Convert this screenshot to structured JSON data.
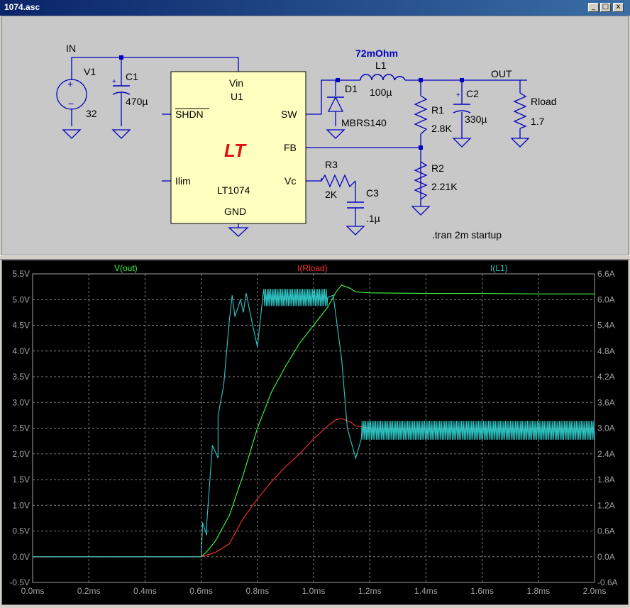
{
  "window": {
    "title": "1074.asc",
    "minimize": "_",
    "restore": "□",
    "close": "x"
  },
  "schematic": {
    "nets": {
      "in": "IN",
      "out": "OUT"
    },
    "v1": {
      "name": "V1",
      "value": "32"
    },
    "c1": {
      "name": "C1",
      "value": "470µ"
    },
    "u1": {
      "vin": "Vin",
      "name": "U1",
      "shdn": "SHDN",
      "sw": "SW",
      "fb": "FB",
      "ilim": "Ilim",
      "vc": "Vc",
      "part": "LT1074",
      "gnd": "GND",
      "logo": "LT"
    },
    "l1": {
      "name": "L1",
      "value": "100µ",
      "rser": "72mOhm"
    },
    "d1": {
      "name": "D1",
      "value": "MBRS140"
    },
    "r1": {
      "name": "R1",
      "value": "2.8K"
    },
    "c2": {
      "name": "C2",
      "value": "330µ"
    },
    "rload": {
      "name": "Rload",
      "value": "1.7"
    },
    "r2": {
      "name": "R2",
      "value": "2.21K"
    },
    "r3": {
      "name": "R3",
      "value": "2K"
    },
    "c3": {
      "name": "C3",
      "value": ".1µ"
    },
    "directive": ".tran 2m startup"
  },
  "colors": {
    "vout": "#40ff40",
    "irload": "#ff3030",
    "il1": "#30c8c8",
    "wire": "#0000c0",
    "plot_bg": "#000000"
  },
  "chart_data": {
    "type": "line",
    "x_ticks": [
      "0.0ms",
      "0.2ms",
      "0.4ms",
      "0.6ms",
      "0.8ms",
      "1.0ms",
      "1.2ms",
      "1.4ms",
      "1.6ms",
      "1.8ms",
      "2.0ms"
    ],
    "xlim": [
      0,
      2.0
    ],
    "left_ylim": [
      -0.5,
      5.5
    ],
    "right_ylim": [
      -0.6,
      6.6
    ],
    "left_ticks": [
      "5.5V",
      "5.0V",
      "4.5V",
      "4.0V",
      "3.5V",
      "3.0V",
      "2.5V",
      "2.0V",
      "1.5V",
      "1.0V",
      "0.5V",
      "0.0V",
      "-0.5V"
    ],
    "right_ticks": [
      "6.6A",
      "6.0A",
      "5.4A",
      "4.8A",
      "4.2A",
      "3.6A",
      "3.0A",
      "2.4A",
      "1.8A",
      "1.2A",
      "0.6A",
      "0.0A",
      "-0.6A"
    ],
    "grid": true,
    "series": [
      {
        "name": "V(out)",
        "axis": "left",
        "x": [
          0,
          0.6,
          0.62,
          0.65,
          0.7,
          0.75,
          0.8,
          0.85,
          0.9,
          0.95,
          1.0,
          1.05,
          1.08,
          1.1,
          1.13,
          1.15,
          1.2,
          1.4,
          1.6,
          1.8,
          2.0
        ],
        "y": [
          0,
          0,
          0.1,
          0.3,
          0.8,
          1.6,
          2.5,
          3.2,
          3.7,
          4.15,
          4.5,
          4.85,
          5.15,
          5.28,
          5.22,
          5.15,
          5.13,
          5.12,
          5.12,
          5.11,
          5.11
        ]
      },
      {
        "name": "I(Rload)",
        "axis": "right",
        "x": [
          0,
          0.6,
          0.65,
          0.7,
          0.75,
          0.8,
          0.85,
          0.9,
          0.95,
          1.0,
          1.05,
          1.08,
          1.1,
          1.13,
          1.15,
          1.2,
          1.4,
          1.6,
          1.8,
          2.0
        ],
        "y": [
          0,
          0,
          0.1,
          0.3,
          0.9,
          1.35,
          1.75,
          2.1,
          2.4,
          2.75,
          3.05,
          3.2,
          3.22,
          3.15,
          3.05,
          3.0,
          3.0,
          3.0,
          3.0,
          3.0
        ]
      },
      {
        "name": "I(L1)",
        "axis": "right",
        "x": [
          0,
          0.6,
          0.605,
          0.62,
          0.62,
          0.64,
          0.66,
          0.66,
          0.68,
          0.7,
          0.71,
          0.72,
          0.74,
          0.75,
          0.76,
          0.78,
          0.8,
          0.82,
          1.05,
          1.07,
          1.1,
          1.12,
          1.15,
          1.17,
          1.2,
          2.0
        ],
        "y": [
          0,
          0,
          0.8,
          0.5,
          0.8,
          2.6,
          2.3,
          3.3,
          4.0,
          5.5,
          6.1,
          5.6,
          6.0,
          5.7,
          6.15,
          5.5,
          4.9,
          6.1,
          6.05,
          6.1,
          4.6,
          3.0,
          2.3,
          2.75,
          2.95,
          2.95
        ],
        "ripple": [
          {
            "x": [
              0.82,
              1.05
            ],
            "center": 6.05,
            "amplitude": 0.2
          },
          {
            "x": [
              1.17,
              2.0
            ],
            "center": 2.95,
            "amplitude": 0.22
          }
        ]
      }
    ]
  }
}
